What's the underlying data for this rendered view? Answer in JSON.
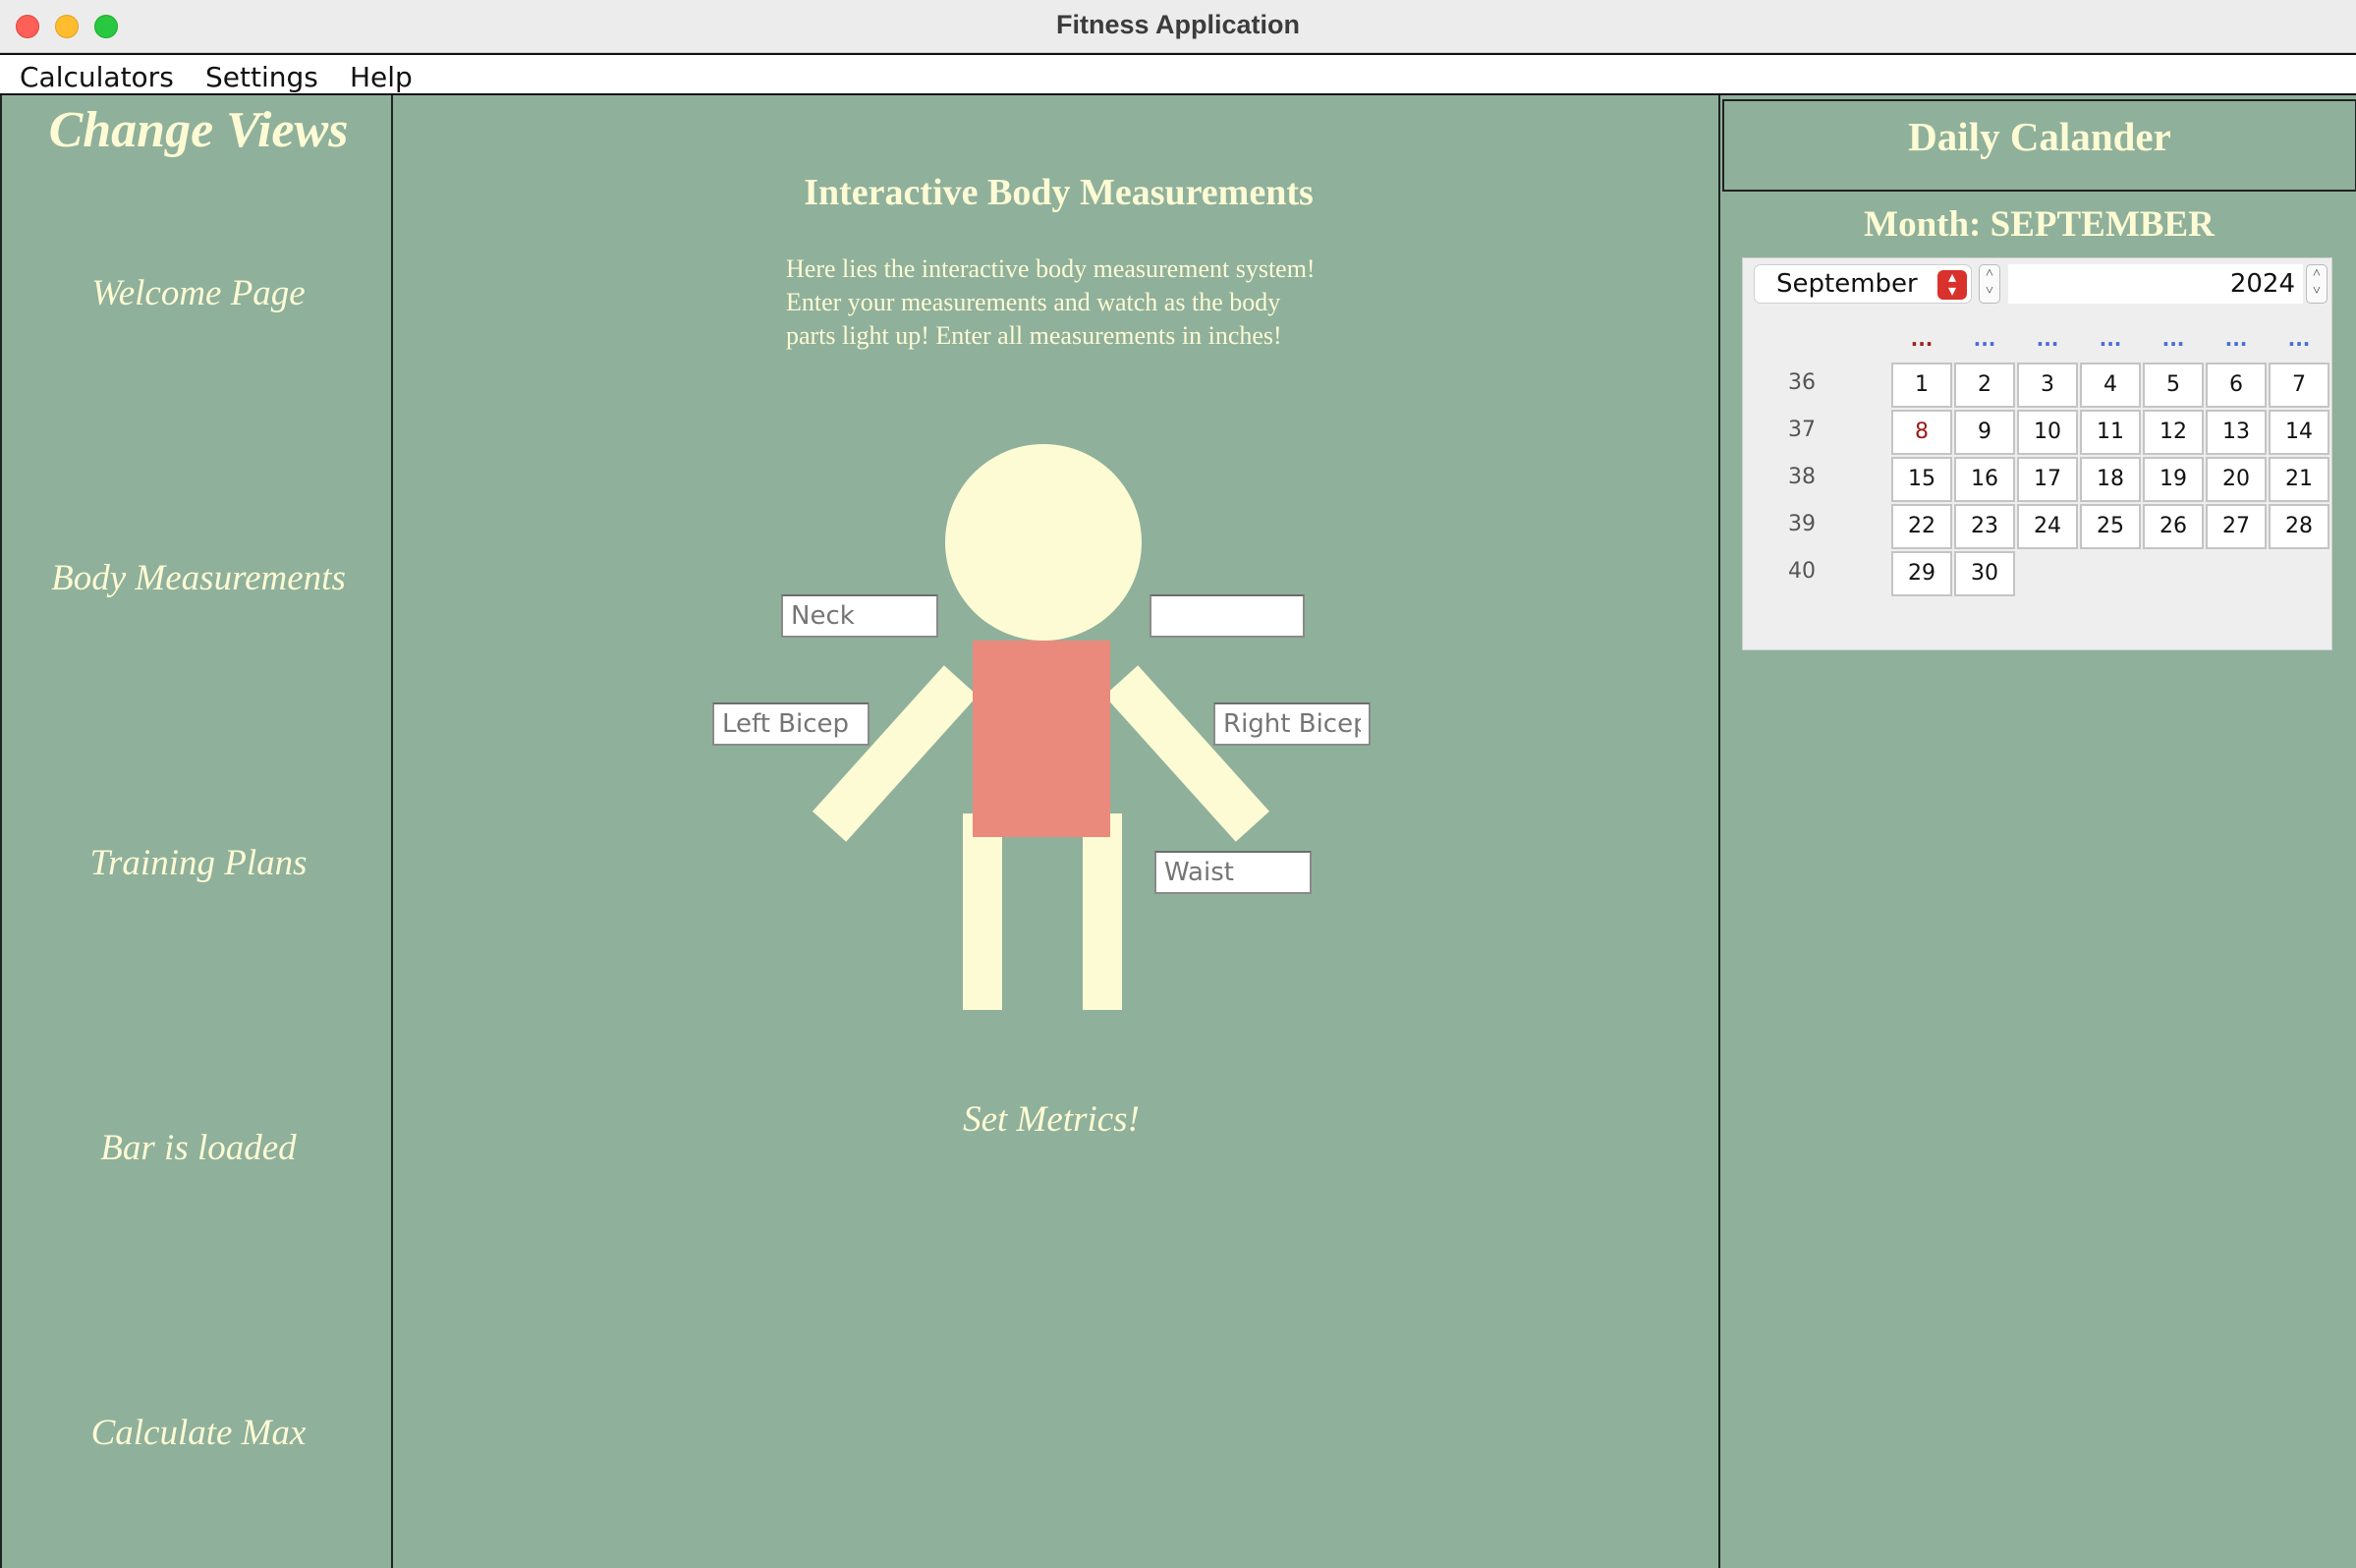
{
  "window": {
    "title": "Fitness Application"
  },
  "menubar": {
    "items": [
      "Calculators",
      "Settings",
      "Help"
    ]
  },
  "sidebar": {
    "title": "Change Views",
    "items": [
      "Welcome Page",
      "Body Measurements",
      "Training Plans",
      "Bar is loaded",
      "Calculate Max"
    ]
  },
  "main": {
    "title": "Interactive Body Measurements",
    "intro_lines": [
      "Here lies the interactive body measurement system!",
      "Enter your measurements and watch as the body",
      "parts light up! Enter all measurements in inches!"
    ],
    "inputs": {
      "neck_placeholder": "Neck",
      "chest_placeholder": "",
      "left_bicep_placeholder": "Left Bicep",
      "right_bicep_placeholder": "Right Bicep",
      "waist_placeholder": "Waist"
    },
    "set_metrics_label": "Set Metrics!",
    "colors": {
      "body": "#fdfbd4",
      "torso_highlight": "#e98a7c",
      "background": "#8fb09b"
    }
  },
  "calendar": {
    "header": "Daily Calander",
    "month_label": "Month: SEPTEMBER",
    "month_select": "September",
    "year": "2024",
    "weekday_headers": [
      "...",
      "...",
      "...",
      "...",
      "...",
      "...",
      "..."
    ],
    "weeks": [
      {
        "num": "36",
        "days": [
          "1",
          "2",
          "3",
          "4",
          "5",
          "6",
          "7"
        ]
      },
      {
        "num": "37",
        "days": [
          "8",
          "9",
          "10",
          "11",
          "12",
          "13",
          "14"
        ]
      },
      {
        "num": "38",
        "days": [
          "15",
          "16",
          "17",
          "18",
          "19",
          "20",
          "21"
        ]
      },
      {
        "num": "39",
        "days": [
          "22",
          "23",
          "24",
          "25",
          "26",
          "27",
          "28"
        ]
      },
      {
        "num": "40",
        "days": [
          "29",
          "30"
        ]
      }
    ],
    "highlighted_day": "8"
  }
}
